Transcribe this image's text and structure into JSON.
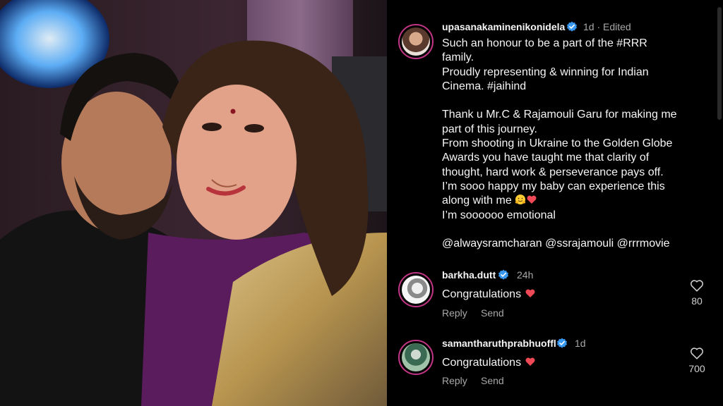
{
  "post": {
    "username": "upasanakaminenikonidela",
    "meta": "1d · Edited",
    "caption_lines": [
      "Such an honour to be a part of the #RRR",
      "family.",
      "Proudly representing & winning for Indian",
      "Cinema. #jaihind",
      "",
      "Thank u Mr.C & Rajamouli Garu for making me",
      "part of this journey.",
      "From shooting in Ukraine to the Golden Globe",
      "Awards you have taught me that clarity of",
      "thought, hard work & perseverance pays off.",
      "I’m sooo happy my baby can experience this",
      "along with me",
      "I’m soooooo emotional",
      "",
      "@alwaysramcharan @ssrajamouli @rrrmovie"
    ],
    "emoji_hug": "hugging-face",
    "emoji_heart": "red-heart"
  },
  "comments": [
    {
      "username": "barkha.dutt",
      "time": "24h",
      "text": "Congratulations",
      "reply_label": "Reply",
      "send_label": "Send",
      "likes": "80"
    },
    {
      "username": "samantharuthprabhuoffl",
      "time": "1d",
      "text": "Congratulations",
      "reply_label": "Reply",
      "send_label": "Send",
      "likes": "700"
    }
  ],
  "colors": {
    "verified": "#3897f0",
    "heart": "#ed4956",
    "story_ring": "#c13584"
  }
}
